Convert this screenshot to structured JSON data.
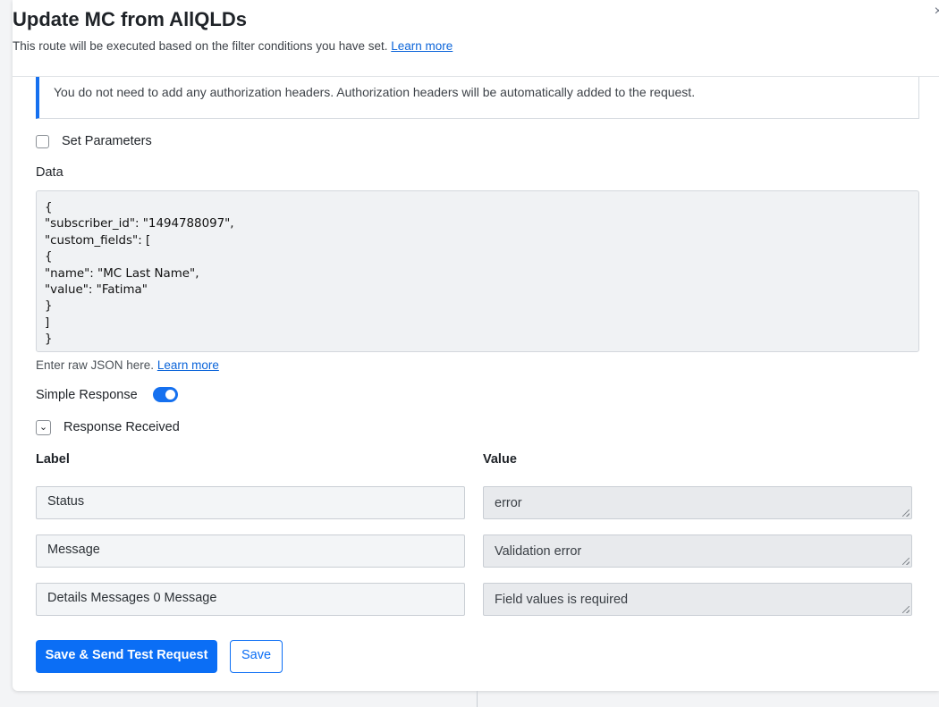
{
  "header": {
    "title": "Update MC from AllQLDs",
    "subtitle": "This route will be executed based on the filter conditions you have set.",
    "learn_more": "Learn more",
    "close": "×"
  },
  "notice": {
    "text": "You do not need to add any authorization headers. Authorization headers will be automatically added to the request."
  },
  "set_parameters": {
    "label": "Set Parameters",
    "checked": false
  },
  "data": {
    "label": "Data",
    "value": "{\n\"subscriber_id\": \"1494788097\",\n\"custom_fields\": [\n{\n\"name\": \"MC Last Name\",\n\"value\": \"Fatima\"\n}\n]\n}",
    "hint": "Enter raw JSON here.",
    "hint_link": "Learn more"
  },
  "simple_response": {
    "label": "Simple Response",
    "enabled": true
  },
  "response_received": {
    "label": "Response Received",
    "expanded": true
  },
  "table": {
    "label_header": "Label",
    "value_header": "Value",
    "rows": [
      {
        "label": "Status",
        "value": "error"
      },
      {
        "label": "Message",
        "value": "Validation error"
      },
      {
        "label": "Details Messages 0 Message",
        "value": "Field values is required"
      }
    ]
  },
  "buttons": {
    "save_send": "Save & Send Test Request",
    "save": "Save"
  },
  "colors": {
    "accent": "#0b6ef5",
    "notice_border": "#1570ef"
  }
}
